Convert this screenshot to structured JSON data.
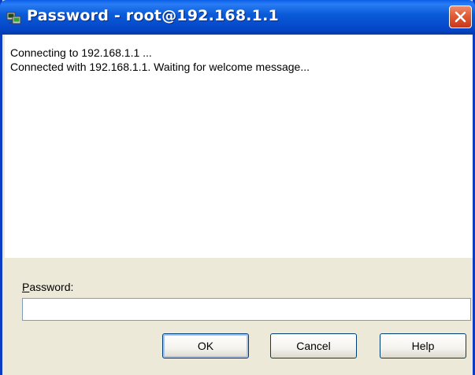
{
  "window": {
    "title": "Password - root@192.168.1.1",
    "icon": "putty-app-icon",
    "close_icon": "close-icon",
    "accent": "#0a5cd9",
    "close_color": "#e25b35"
  },
  "log": {
    "lines": [
      "Connecting to 192.168.1.1 ...",
      "Connected with 192.168.1.1. Waiting for welcome message..."
    ]
  },
  "prompt": {
    "label_mnemonic": "P",
    "label_rest": "assword:",
    "value": ""
  },
  "buttons": {
    "ok": "OK",
    "cancel": "Cancel",
    "help": "Help"
  }
}
